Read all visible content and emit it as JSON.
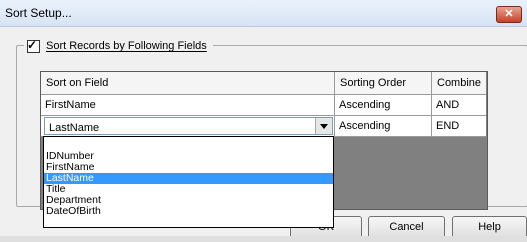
{
  "window": {
    "title": "Sort Setup...",
    "close_glyph": "✕"
  },
  "group": {
    "checkbox_checked": true,
    "label": "Sort Records by Following Fields"
  },
  "grid": {
    "columns": [
      "Sort on Field",
      "Sorting Order",
      "Combine"
    ],
    "rows": [
      {
        "field": "FirstName",
        "order": "Ascending",
        "combine": "AND"
      },
      {
        "field": "LastName",
        "order": "Ascending",
        "combine": "END"
      }
    ]
  },
  "dropdown": {
    "options": [
      "IDNumber",
      "FirstName",
      "LastName",
      "Title",
      "Department",
      "DateOfBirth"
    ],
    "selected": "LastName"
  },
  "buttons": {
    "ok": "OK",
    "cancel": "Cancel",
    "help": "Help"
  },
  "colors": {
    "selection": "#3399ff",
    "grid_background": "#808080"
  },
  "icons": {
    "close": "close-icon",
    "dropdown": "chevron-down-icon",
    "checkbox": "checkmark-icon"
  }
}
